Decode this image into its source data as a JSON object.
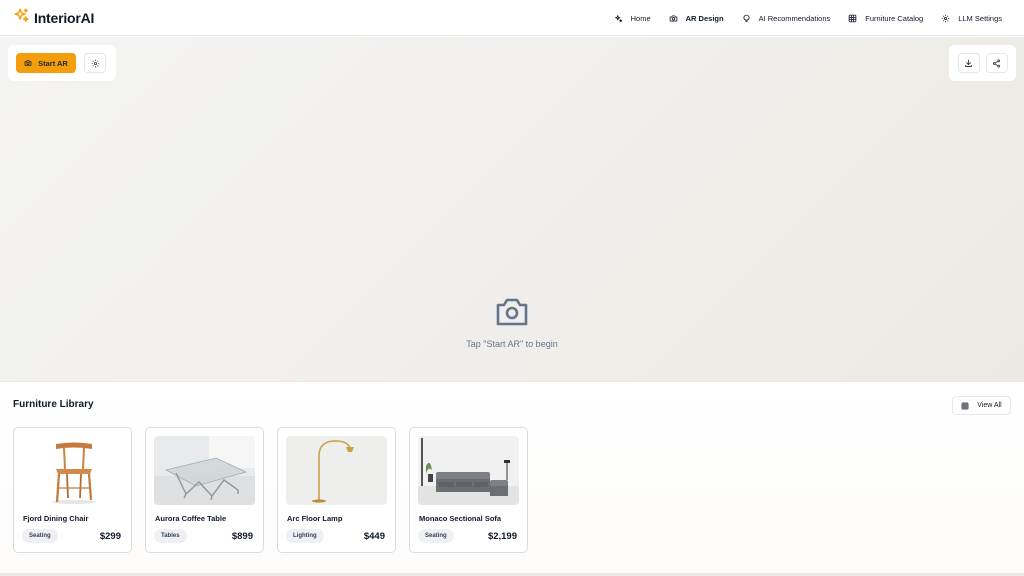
{
  "app": {
    "name": "InteriorAI",
    "brand_color": "#f59e0b"
  },
  "nav": {
    "items": [
      {
        "label": "Home",
        "icon": "sparkles-icon"
      },
      {
        "label": "AR Design",
        "icon": "camera-icon",
        "active": true
      },
      {
        "label": "AI Recommendations",
        "icon": "lightbulb-icon"
      },
      {
        "label": "Furniture Catalog",
        "icon": "grid-icon"
      },
      {
        "label": "LLM Settings",
        "icon": "gear-icon"
      }
    ]
  },
  "viewport": {
    "start_ar_label": "Start AR",
    "settings_icon": "gear-icon",
    "download_icon": "download-icon",
    "share_icon": "share-icon",
    "placeholder_icon": "camera-icon",
    "placeholder_text": "Tap \"Start AR\" to begin"
  },
  "library": {
    "title": "Furniture Library",
    "view_all_label": "View All",
    "items": [
      {
        "name": "Fjord Dining Chair",
        "category": "Seating",
        "price": "$299"
      },
      {
        "name": "Aurora Coffee Table",
        "category": "Tables",
        "price": "$899"
      },
      {
        "name": "Arc Floor Lamp",
        "category": "Lighting",
        "price": "$449"
      },
      {
        "name": "Monaco Sectional Sofa",
        "category": "Seating",
        "price": "$2,199"
      }
    ]
  }
}
